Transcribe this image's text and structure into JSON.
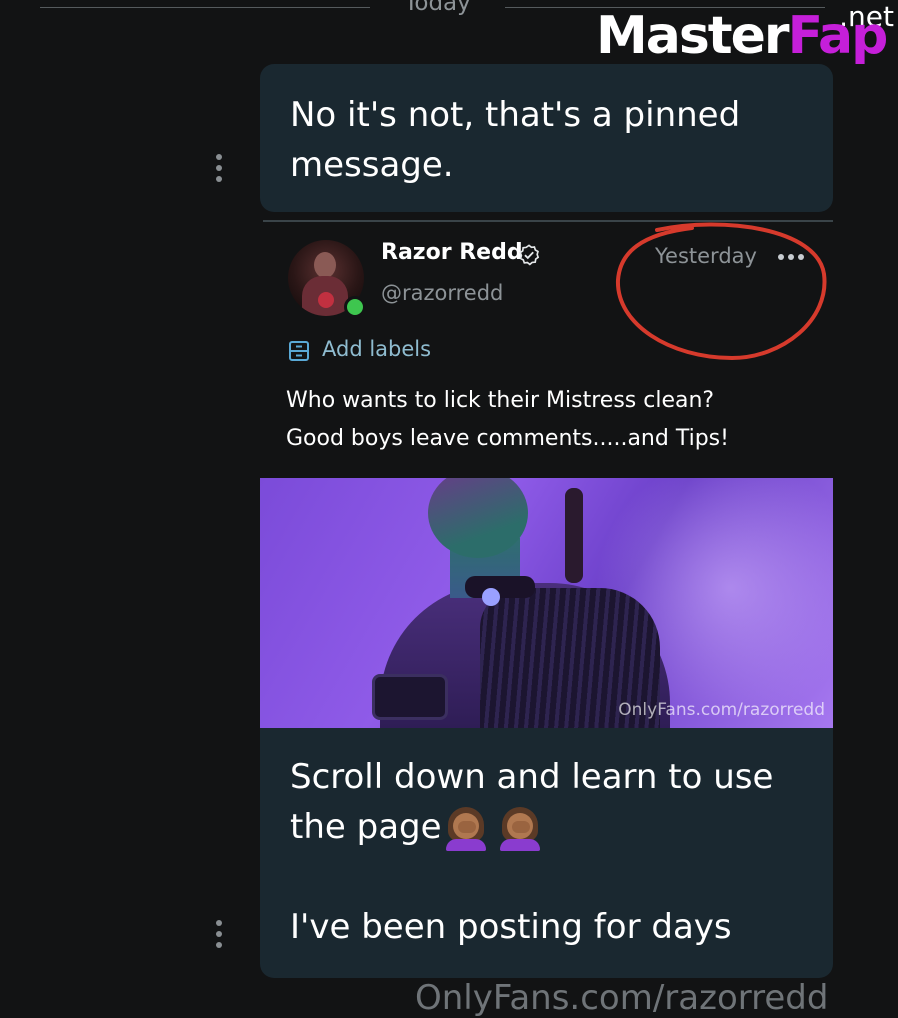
{
  "date_separator": "Today",
  "watermark": {
    "brand_a": "Master",
    "brand_b": "Fap",
    "tld": ".net"
  },
  "messages": [
    {
      "text": "No it's not, that's a pinned message."
    }
  ],
  "post": {
    "author_name": "Razor Redd",
    "author_handle": "@razorredd",
    "timestamp": "Yesterday",
    "add_labels": "Add labels",
    "text_line1": "Who wants to lick their Mistress clean?",
    "text_line2": "Good boys leave comments.....and Tips!",
    "media_watermark": "OnlyFans.com/razorredd"
  },
  "reply": {
    "line1": "Scroll down and learn to use",
    "line2": "the page",
    "line3": "I've been posting for days",
    "emoji": [
      "facepalm-icon",
      "facepalm-icon"
    ]
  },
  "footer_ghost": "OnlyFans.com/razorredd",
  "colors": {
    "background": "#121314",
    "bubble": "#1a2830",
    "muted_text": "#8d9397",
    "link": "#8fbcd0",
    "online": "#3ec64f",
    "annotation": "#d63a2c"
  }
}
